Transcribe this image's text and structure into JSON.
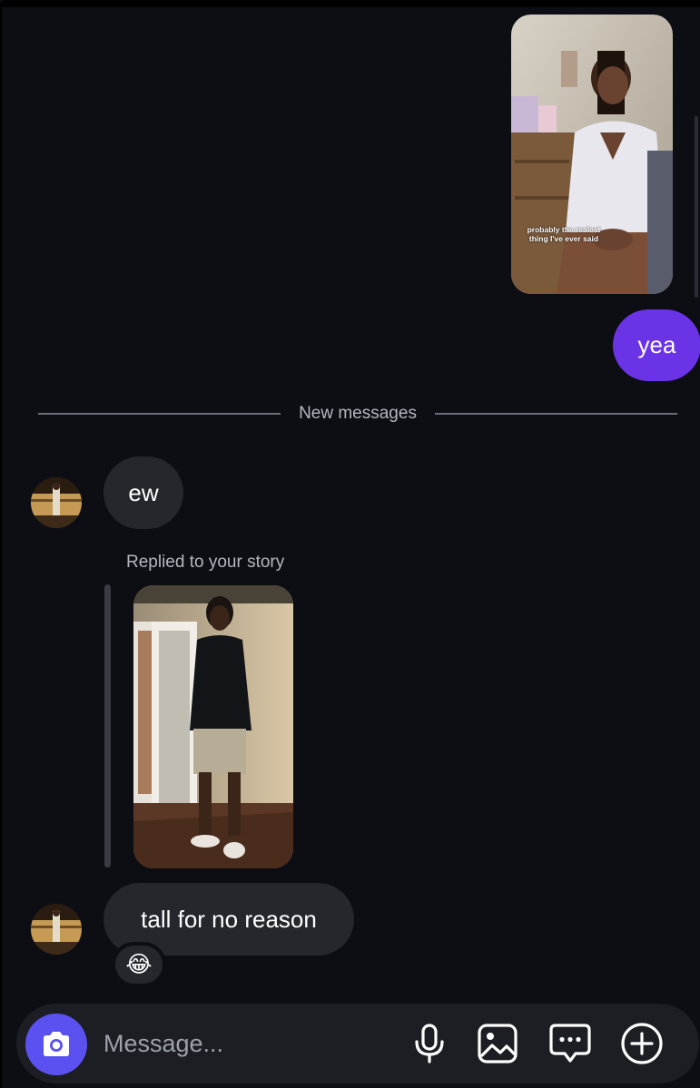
{
  "thread": {
    "sent_story": {
      "caption": "probably the realest thing I've ever said"
    },
    "sent_message": "yea",
    "divider_label": "New messages",
    "received": [
      {
        "text": "ew"
      },
      {
        "text": "tall for no reason",
        "reaction": "😂"
      }
    ],
    "story_reply_label": "Replied to your story"
  },
  "composer": {
    "placeholder": "Message...",
    "camera_icon": "camera-icon",
    "tools": [
      "microphone-icon",
      "image-icon",
      "sticker-chat-icon",
      "plus-circle-icon"
    ]
  },
  "colors": {
    "background": "#0c0e14",
    "sent_bubble": "#6a33e6",
    "received_bubble": "#25272d",
    "camera_button": "#5a51f0"
  }
}
